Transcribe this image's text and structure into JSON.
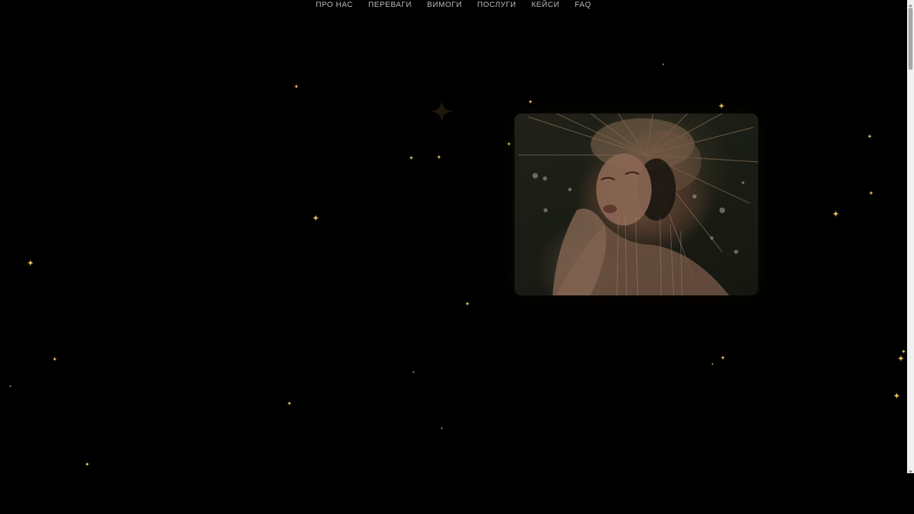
{
  "nav": {
    "items": [
      {
        "label": "ПРО НАС"
      },
      {
        "label": "ПЕРЕВАГИ"
      },
      {
        "label": "ВИМОГИ"
      },
      {
        "label": "ПОСЛУГИ"
      },
      {
        "label": "КЕЙСИ"
      },
      {
        "label": "FAQ"
      }
    ]
  },
  "theme": {
    "background": "#000000",
    "nav_text": "#bdbdbd",
    "sparkle": "#e8c25a",
    "scrollbar_track": "#f1f1f1",
    "scrollbar_thumb": "#a8a8a8"
  },
  "icons": {
    "sparkle": "sparkle-star-icon",
    "scroll_up": "chevron-up-icon",
    "scroll_down": "chevron-down-icon"
  },
  "hero": {
    "image": "woman-with-golden-crown-photo"
  }
}
